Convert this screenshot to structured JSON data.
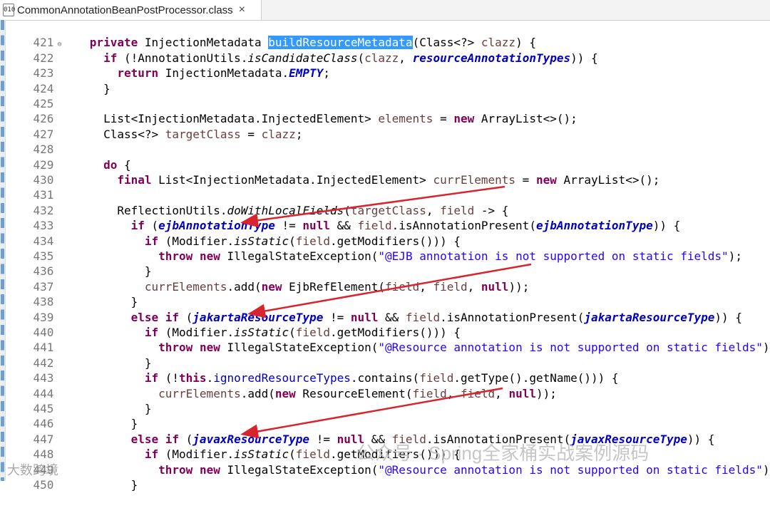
{
  "tab": {
    "icon_label": "010",
    "title": "CommonAnnotationBeanPostProcessor.class",
    "close": "×"
  },
  "lines": [
    {
      "no": "421",
      "fold": "⊖"
    },
    {
      "no": "422"
    },
    {
      "no": "423"
    },
    {
      "no": "424"
    },
    {
      "no": "425"
    },
    {
      "no": "426"
    },
    {
      "no": "427"
    },
    {
      "no": "428"
    },
    {
      "no": "429"
    },
    {
      "no": "430"
    },
    {
      "no": "431"
    },
    {
      "no": "432"
    },
    {
      "no": "433"
    },
    {
      "no": "434"
    },
    {
      "no": "435"
    },
    {
      "no": "436"
    },
    {
      "no": "437"
    },
    {
      "no": "438"
    },
    {
      "no": "439"
    },
    {
      "no": "440"
    },
    {
      "no": "441"
    },
    {
      "no": "442"
    },
    {
      "no": "443"
    },
    {
      "no": "444"
    },
    {
      "no": "445"
    },
    {
      "no": "446"
    },
    {
      "no": "447"
    },
    {
      "no": "448"
    },
    {
      "no": "449"
    },
    {
      "no": "450"
    }
  ],
  "code": {
    "l421": {
      "kw": "private",
      "t1": " InjectionMetadata ",
      "method": "buildResourceMetadata",
      "t2": "(Class<?> ",
      "var": "clazz",
      "t3": ") {"
    },
    "l422": {
      "kw": "if",
      "t1": " (!AnnotationUtils.",
      "m": "isCandidateClass",
      "t2": "(",
      "var": "clazz",
      "t3": ", ",
      "fld": "resourceAnnotationTypes",
      "t4": ")) {"
    },
    "l423": {
      "kw": "return",
      "t1": " InjectionMetadata.",
      "st": "EMPTY",
      "t2": ";"
    },
    "l424": {
      "t1": "}"
    },
    "l426": {
      "t1": "List<InjectionMetadata.InjectedElement> ",
      "var": "elements",
      "t2": " = ",
      "kw": "new",
      "t3": " ArrayList<>();"
    },
    "l427": {
      "t1": "Class<?> ",
      "var": "targetClass",
      "t2": " = ",
      "var2": "clazz",
      "t3": ";"
    },
    "l429": {
      "kw": "do",
      "t1": " {"
    },
    "l430": {
      "kw": "final",
      "t1": " List<InjectionMetadata.InjectedElement> ",
      "var": "currElements",
      "t2": " = ",
      "kw2": "new",
      "t3": " ArrayList<>();"
    },
    "l432": {
      "t1": "ReflectionUtils.",
      "m": "doWithLocalFields",
      "t2": "(",
      "var": "targetClass",
      "t3": ", ",
      "var2": "field",
      "t4": " -> {"
    },
    "l433": {
      "kw": "if",
      "t1": " (",
      "fld": "ejbAnnotationType",
      "t2": " != ",
      "kw2": "null",
      "t3": " && ",
      "var": "field",
      "t4": ".isAnnotationPresent(",
      "fld2": "ejbAnnotationType",
      "t5": ")) {"
    },
    "l434": {
      "kw": "if",
      "t1": " (Modifier.",
      "m": "isStatic",
      "t2": "(",
      "var": "field",
      "t3": ".getModifiers())) {"
    },
    "l435": {
      "kw": "throw",
      "t1": " ",
      "kw2": "new",
      "t2": " IllegalStateException(",
      "str": "\"@EJB annotation is not supported on static fields\"",
      "t3": ");"
    },
    "l436": {
      "t1": "}"
    },
    "l437": {
      "var": "currElements",
      "t1": ".add(",
      "kw": "new",
      "t2": " EjbRefElement(",
      "var2": "field",
      "t3": ", ",
      "var3": "field",
      "t4": ", ",
      "kw2": "null",
      "t5": "));"
    },
    "l438": {
      "t1": "}"
    },
    "l439": {
      "kw": "else",
      "t0": " ",
      "kw2": "if",
      "t1": " (",
      "fld": "jakartaResourceType",
      "t2": " != ",
      "kw3": "null",
      "t3": " && ",
      "var": "field",
      "t4": ".isAnnotationPresent(",
      "fld2": "jakartaResourceType",
      "t5": ")) {"
    },
    "l440": {
      "kw": "if",
      "t1": " (Modifier.",
      "m": "isStatic",
      "t2": "(",
      "var": "field",
      "t3": ".getModifiers())) {"
    },
    "l441": {
      "kw": "throw",
      "t1": " ",
      "kw2": "new",
      "t2": " IllegalStateException(",
      "str": "\"@Resource annotation is not supported on static fields\"",
      "t3": ");"
    },
    "l442": {
      "t1": "}"
    },
    "l443": {
      "kw": "if",
      "t1": " (!",
      "kw2": "this",
      "t2": ".",
      "fld": "ignoredResourceTypes",
      "t3": ".contains(",
      "var": "field",
      "t4": ".getType().getName())) {"
    },
    "l444": {
      "var": "currElements",
      "t1": ".add(",
      "kw": "new",
      "t2": " ResourceElement(",
      "var2": "field",
      "t3": ", ",
      "var3": "field",
      "t4": ", ",
      "kw2": "null",
      "t5": "));"
    },
    "l445": {
      "t1": "}"
    },
    "l446": {
      "t1": "}"
    },
    "l447": {
      "kw": "else",
      "t0": " ",
      "kw2": "if",
      "t1": " (",
      "fld": "javaxResourceType",
      "t2": " != ",
      "kw3": "null",
      "t3": " && ",
      "var": "field",
      "t4": ".isAnnotationPresent(",
      "fld2": "javaxResourceType",
      "t5": ")) {"
    },
    "l448": {
      "kw": "if",
      "t1": " (Modifier.",
      "m": "isStatic",
      "t2": "(",
      "var": "field",
      "t3": ".getModifiers())) {"
    },
    "l449": {
      "kw": "throw",
      "t1": " ",
      "kw2": "new",
      "t2": " IllegalStateException(",
      "str": "\"@Resource annotation is not supported on static fields\"",
      "t3": ");"
    },
    "l450": {
      "t1": "}"
    }
  },
  "watermark": {
    "main": "公众号 · Spring全家桶实战案例源码",
    "small": "大数跨境"
  },
  "colors": {
    "keyword": "#7f0055",
    "field": "#0000c0",
    "string": "#2a00ff",
    "variable": "#6a3e3e",
    "selection": "#3399ff",
    "annotation_arrow": "#d9232e"
  }
}
